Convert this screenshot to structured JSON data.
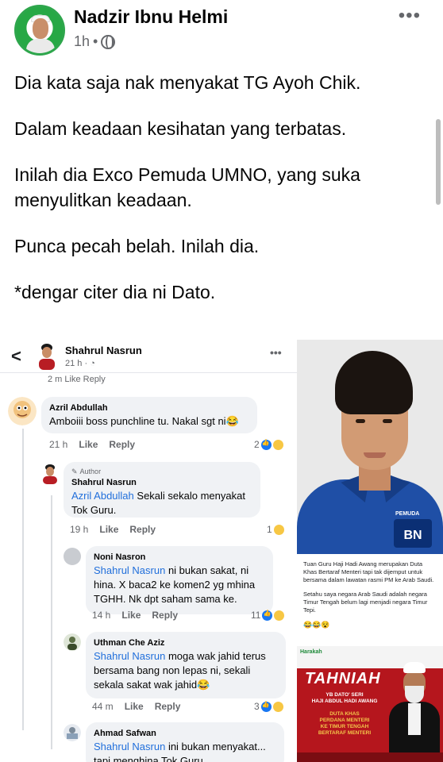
{
  "post": {
    "author": "Nadzir Ibnu Helmi",
    "time": "1h",
    "separator": "•",
    "more": "•••",
    "paragraphs": [
      "Dia kata saja nak menyakat TG Ayoh Chik.",
      "Dalam keadaan kesihatan yang terbatas.",
      "Inilah dia Exco Pemuda UMNO, yang suka menyulitkan keadaan.",
      "Punca pecah belah. Inilah dia.",
      "*dengar citer dia ni Dato."
    ]
  },
  "screenshot": {
    "back": "<",
    "poster_name": "Shahrul Nasrun",
    "poster_time": "21 h · ",
    "more": "•••",
    "cut_row": "2 m    Like    Reply",
    "comments": [
      {
        "name": "Azril Abdullah",
        "text": "Amboiii boss punchline tu. Nakal sgt ni😂",
        "time": "21 h",
        "like": "Like",
        "reply": "Reply",
        "reactions": "2"
      },
      {
        "badge": "Author",
        "name": "Shahrul Nasrun",
        "tag": "Azril Abdullah",
        "text": " Sekali sekalo menyakat Tok Guru.",
        "time": "19 h",
        "like": "Like",
        "reply": "Reply",
        "reactions": "1"
      },
      {
        "name": "Noni Nasron",
        "tag": "Shahrul Nasrun",
        "text": " ni bukan sakat, ni hina. X baca2 ke komen2 yg mhina TGHH. Nk dpt saham sama ke.",
        "time": "14 h",
        "like": "Like",
        "reply": "Reply",
        "reactions": "11"
      },
      {
        "name": "Uthman Che Aziz",
        "tag": "Shahrul Nasrun",
        "text": " moga wak jahid terus bersama bang non lepas ni, sekali sekala sakat wak jahid😂",
        "time": "44 m",
        "like": "Like",
        "reply": "Reply",
        "reactions": "3"
      },
      {
        "name": "Ahmad Safwan",
        "tag": "Shahrul Nasrun",
        "text": " ini bukan menyakat... tapi menghina Tok Guru.."
      }
    ]
  },
  "side": {
    "photo_badge": "BN",
    "photo_badge_small": "PEMUDA",
    "caption_p1": "Tuan Guru Haji Hadi Awang merupakan Duta Khas Bertaraf Menteri tapi tak dijemput untuk bersama dalam lawatan rasmi PM ke Arab Saudi.",
    "caption_p2": "Setahu saya negara Arab Saudi adalah negara Timur Tengah belum lagi menjadi negara Timur Tepi.",
    "caption_emoji": "😂😂😵",
    "poster_logo": "Harakah",
    "poster_title": "TAHNIAH",
    "poster_l1": "YB DATO' SERI",
    "poster_l2": "HAJI ABDUL HADI AWANG",
    "poster_l3": "DUTA KHAS",
    "poster_l4": "PERDANA MENTERI",
    "poster_l5": "KE TIMUR TENGAH",
    "poster_l6": "BERTARAF MENTERI"
  },
  "colors": {
    "link": "#216fdb",
    "meta": "#65676b",
    "shirt": "#1f4fa6",
    "poster_red": "#b5161d"
  }
}
